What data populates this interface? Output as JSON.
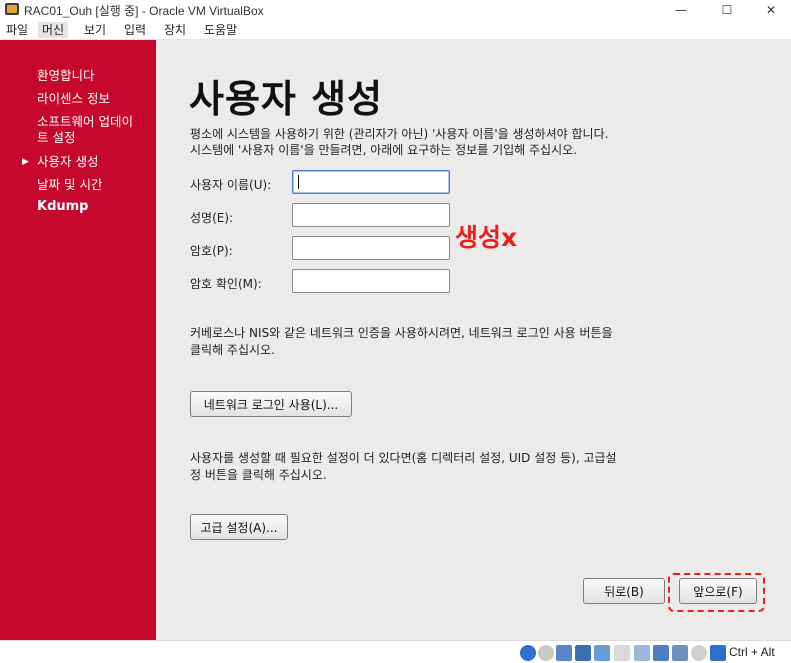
{
  "window": {
    "title": "RAC01_Ouh [실행 중] - Oracle VM VirtualBox",
    "minimize": "—",
    "maximize": "☐",
    "close": "✕"
  },
  "menu": [
    "파일",
    "머신",
    "보기",
    "입력",
    "장치",
    "도움말"
  ],
  "sidebar": {
    "items": [
      "환영합니다",
      "라이센스 정보",
      "소프트웨어 업데이트 설정",
      "사용자 생성",
      "날짜 및 시간",
      "Kdump"
    ],
    "current": "사용자 생성",
    "current_marker": "▶"
  },
  "page": {
    "heading": "사용자 생성",
    "intro_line1": "평소에 시스템을 사용하기 위한 (관리자가 아닌) '사용자 이름'을 생성하셔야 합니다.",
    "intro_line2": "시스템에 '사용자 이름'을 만들려면, 아래에 요구하는 정보를 기입해 주십시오.",
    "fields": [
      {
        "label": "사용자 이름(U):",
        "value": ""
      },
      {
        "label": "성명(E):",
        "value": ""
      },
      {
        "label": "암호(P):",
        "value": ""
      },
      {
        "label": "암호 확인(M):",
        "value": ""
      }
    ],
    "annotation": "생성x",
    "network_text_line1": "커베로스나 NIS와 같은 네트워크 인증을 사용하시려면, 네트워크 로그인 사용 버튼을",
    "network_text_line2": "클릭해 주십시오.",
    "network_button": "네트워크 로그인 사용(L)...",
    "advanced_text_line1": "사용자를 생성할 때 필요한 설정이 더 있다면(홈 디렉터리 설정, UID 설정 등), 고급설",
    "advanced_text_line2": "정 버튼을 클릭해 주십시오.",
    "advanced_button": "고급 설정(A)...",
    "back_button": "뒤로(B)",
    "forward_button": "앞으로(F)"
  },
  "statusbar": {
    "host_key": "Ctrl + Alt"
  },
  "colors": {
    "sidebar": "#c5082b",
    "annotation": "#ee1c1c",
    "content_bg": "#edebea"
  }
}
